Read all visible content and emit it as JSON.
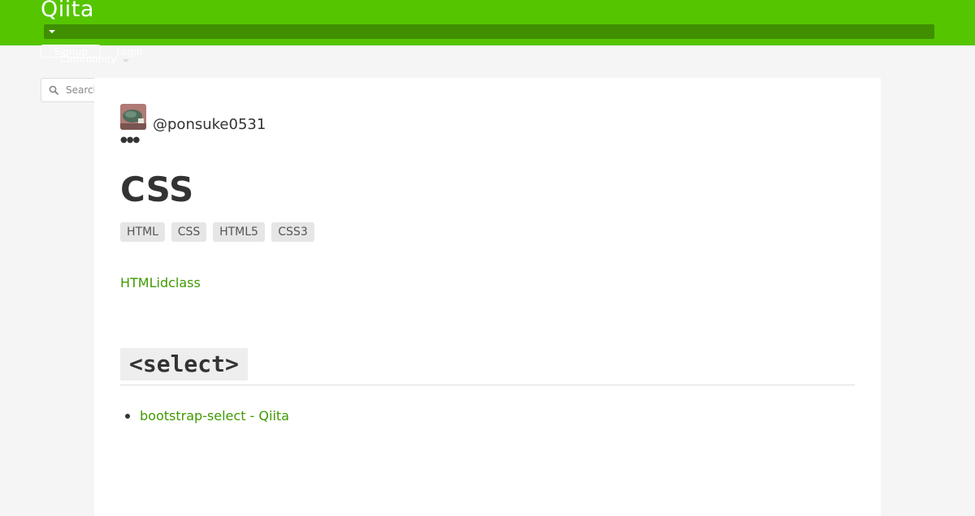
{
  "header": {
    "logo": "Qiita",
    "community_label": "Community",
    "signup_label": "Signup",
    "login_label": "Login",
    "brand_color": "#55c500"
  },
  "search": {
    "placeholder": "Search",
    "icon": "search-icon"
  },
  "article": {
    "author": "@ponsuke0531",
    "title": "CSS",
    "tags": [
      "HTML",
      "CSS",
      "HTML5",
      "CSS3"
    ],
    "intro_link": "HTMLidclass",
    "section_heading": "<select>",
    "links": [
      "bootstrap-select - Qiita"
    ],
    "link_color": "#3f9a00"
  }
}
